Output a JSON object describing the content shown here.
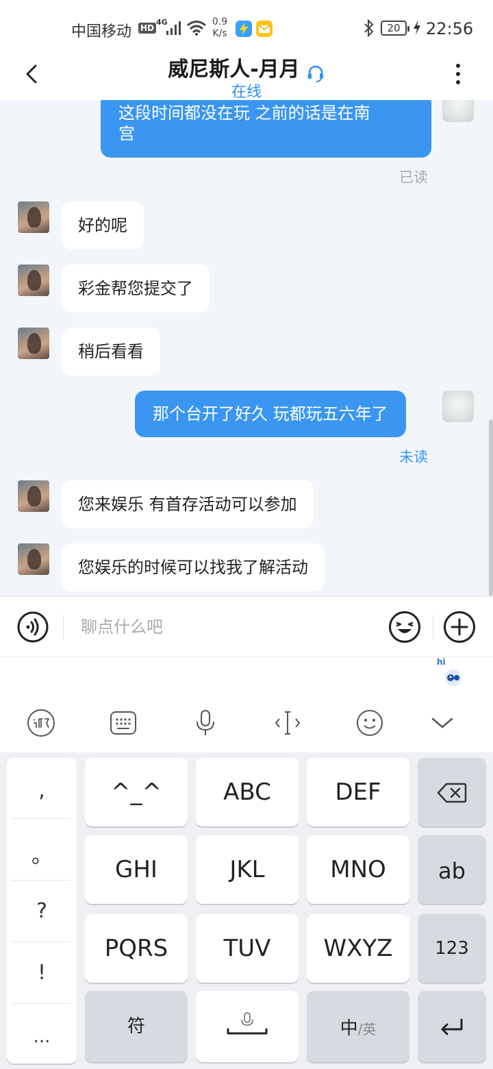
{
  "status_bar": {
    "carrier": "中国移动",
    "hd": "HD",
    "network": "4G",
    "speed_value": "0.9",
    "speed_unit": "K/s",
    "battery": "20",
    "time": "22:56"
  },
  "header": {
    "title": "威尼斯人-月月",
    "status": "在线"
  },
  "messages": [
    {
      "side": "out",
      "lines": [
        "这段时间都没在玩  之前的话是在南",
        "宫"
      ],
      "status": "已读"
    },
    {
      "side": "in",
      "text": "好的呢"
    },
    {
      "side": "in",
      "text": "彩金帮您提交了"
    },
    {
      "side": "in",
      "text": "稍后看看"
    },
    {
      "side": "out",
      "lines": [
        "那个台开了好久  玩都玩五六年了"
      ],
      "status": "未读"
    },
    {
      "side": "in",
      "text": "您来娱乐 有首存活动可以参加"
    },
    {
      "side": "in",
      "text": "您娱乐的时候可以找我了解活动"
    }
  ],
  "input": {
    "placeholder": "聊点什么吧"
  },
  "keyboard": {
    "mascot_label": "hi",
    "punctuation": [
      ",",
      "。",
      "?",
      "!",
      "..."
    ],
    "row1": [
      "^_^",
      "ABC",
      "DEF"
    ],
    "row2": [
      "GHI",
      "JKL",
      "MNO"
    ],
    "row3": [
      "PQRS",
      "TUV",
      "WXYZ"
    ],
    "toggle_ab": "ab",
    "toggle_123": "123",
    "symbol_key": "符",
    "lang_key_main": "中",
    "lang_key_sub": "/英"
  },
  "colors": {
    "accent": "#3a96f0",
    "chat_bg": "#f2f6fa",
    "status_online": "#2f8ef0"
  }
}
